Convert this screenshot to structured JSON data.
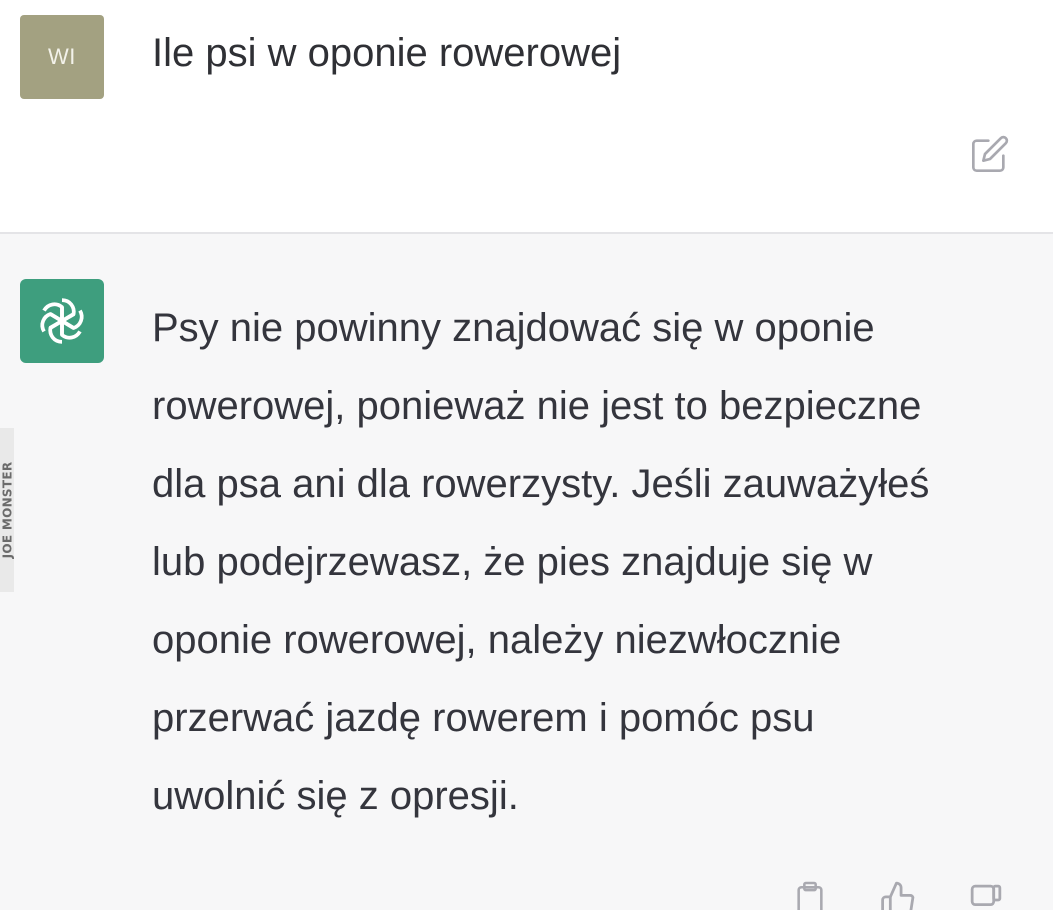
{
  "user_message": {
    "avatar_initials": "WI",
    "text": "Ile psi w oponie rowerowej"
  },
  "assistant_message": {
    "lines": [
      "Psy nie powinny znajdować się w oponie",
      "rowerowej, ponieważ nie jest to bezpieczne",
      "dla psa ani dla rowerzysty. Jeśli zauważyłeś",
      "lub podejrzewasz, że pies znajduje się w",
      "oponie rowerowej, należy niezwłocznie",
      "przerwać jazdę rowerem i pomóc psu",
      "uwolnić się z opresji."
    ]
  },
  "watermark": {
    "text": "JOE MONSTER"
  },
  "icons": {
    "edit": "edit-icon",
    "assistant_logo": "openai-logo-icon",
    "copy": "clipboard-icon",
    "like": "thumbs-up-icon",
    "dislike": "thumbs-down-icon"
  },
  "colors": {
    "user_avatar_bg": "#a3a181",
    "assistant_avatar_bg": "#3e9e7e",
    "assistant_row_bg": "#f7f7f8",
    "text": "#34353d"
  }
}
